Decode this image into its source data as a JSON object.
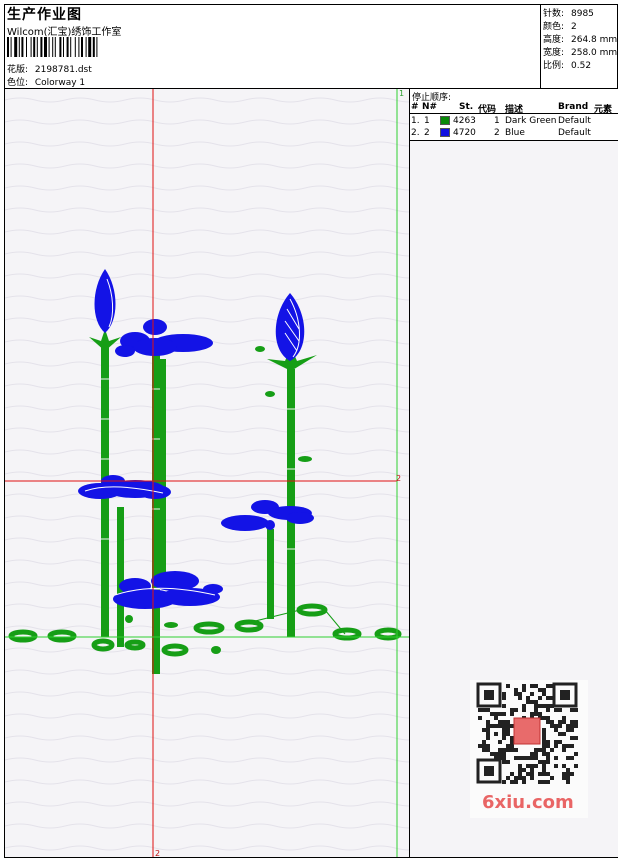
{
  "header": {
    "title": "生产作业图",
    "studio": "Wilcom(汇宝)绣饰工作室",
    "design_label": "花版:",
    "design_value": "2198781.dst",
    "colorway_label": "色位:",
    "colorway_value": "Colorway 1"
  },
  "stats": [
    {
      "label": "针数:",
      "value": "8985"
    },
    {
      "label": "颜色:",
      "value": "2"
    },
    {
      "label": "高度:",
      "value": "264.8 mm"
    },
    {
      "label": "宽度:",
      "value": "258.0 mm"
    },
    {
      "label": "比例:",
      "value": "0.52"
    }
  ],
  "canvas": {
    "guide_top_label": "1",
    "guide_right_label": "2",
    "guide_bottom_label": "2"
  },
  "stop_sequence": {
    "title": "停止顺序:",
    "columns": [
      "#",
      "N#",
      "St.",
      "代码",
      "描述",
      "Brand",
      "元素"
    ],
    "rows": [
      {
        "index": "1.",
        "n": "1",
        "code": "4263",
        "st": "1",
        "desc": "Dark Green",
        "brand": "Default",
        "color": "#0a8a0a"
      },
      {
        "index": "2.",
        "n": "2",
        "code": "4720",
        "st": "2",
        "desc": "Blue",
        "brand": "Default",
        "color": "#1010e0"
      }
    ]
  },
  "watermark": {
    "text": "6xiu.com"
  },
  "colors": {
    "stem_green": "#169e16",
    "flower_blue": "#1313e6",
    "guide_red": "#e01010",
    "guide_green": "#30d030"
  }
}
